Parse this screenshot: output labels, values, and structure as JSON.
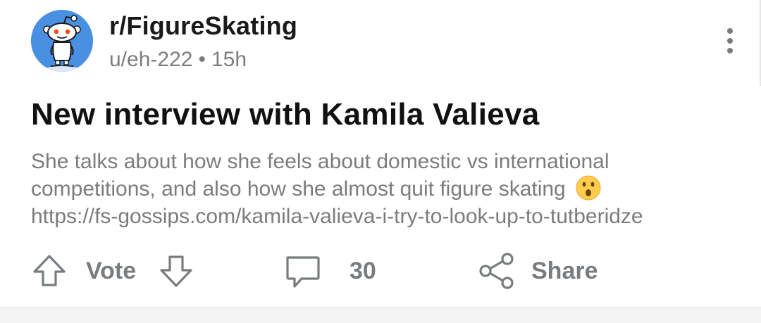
{
  "post": {
    "subreddit": "r/FigureSkating",
    "author": "u/eh-222",
    "separator": "•",
    "age": "15h",
    "title": "New interview with Kamila Valieva",
    "body_line1": "She talks about how she feels about domestic vs international",
    "body_line2": "competitions, and also how she almost quit figure skating",
    "emoji": "hushed-face-emoji",
    "link": "https://fs-gossips.com/kamila-valieva-i-try-to-look-up-to-tutberidze"
  },
  "actions": {
    "vote_label": "Vote",
    "comment_count": "30",
    "share_label": "Share"
  },
  "icons": {
    "avatar": "snoo-skater-avatar",
    "more": "more-vertical-icon",
    "upvote": "upvote-arrow-icon",
    "downvote": "downvote-arrow-icon",
    "comment": "comment-bubble-icon",
    "share": "share-icon"
  },
  "colors": {
    "avatar_bg": "#4a90e2",
    "muted_text": "#7c7c7c",
    "icon_gray": "#787c7e",
    "title_text": "#111111"
  }
}
